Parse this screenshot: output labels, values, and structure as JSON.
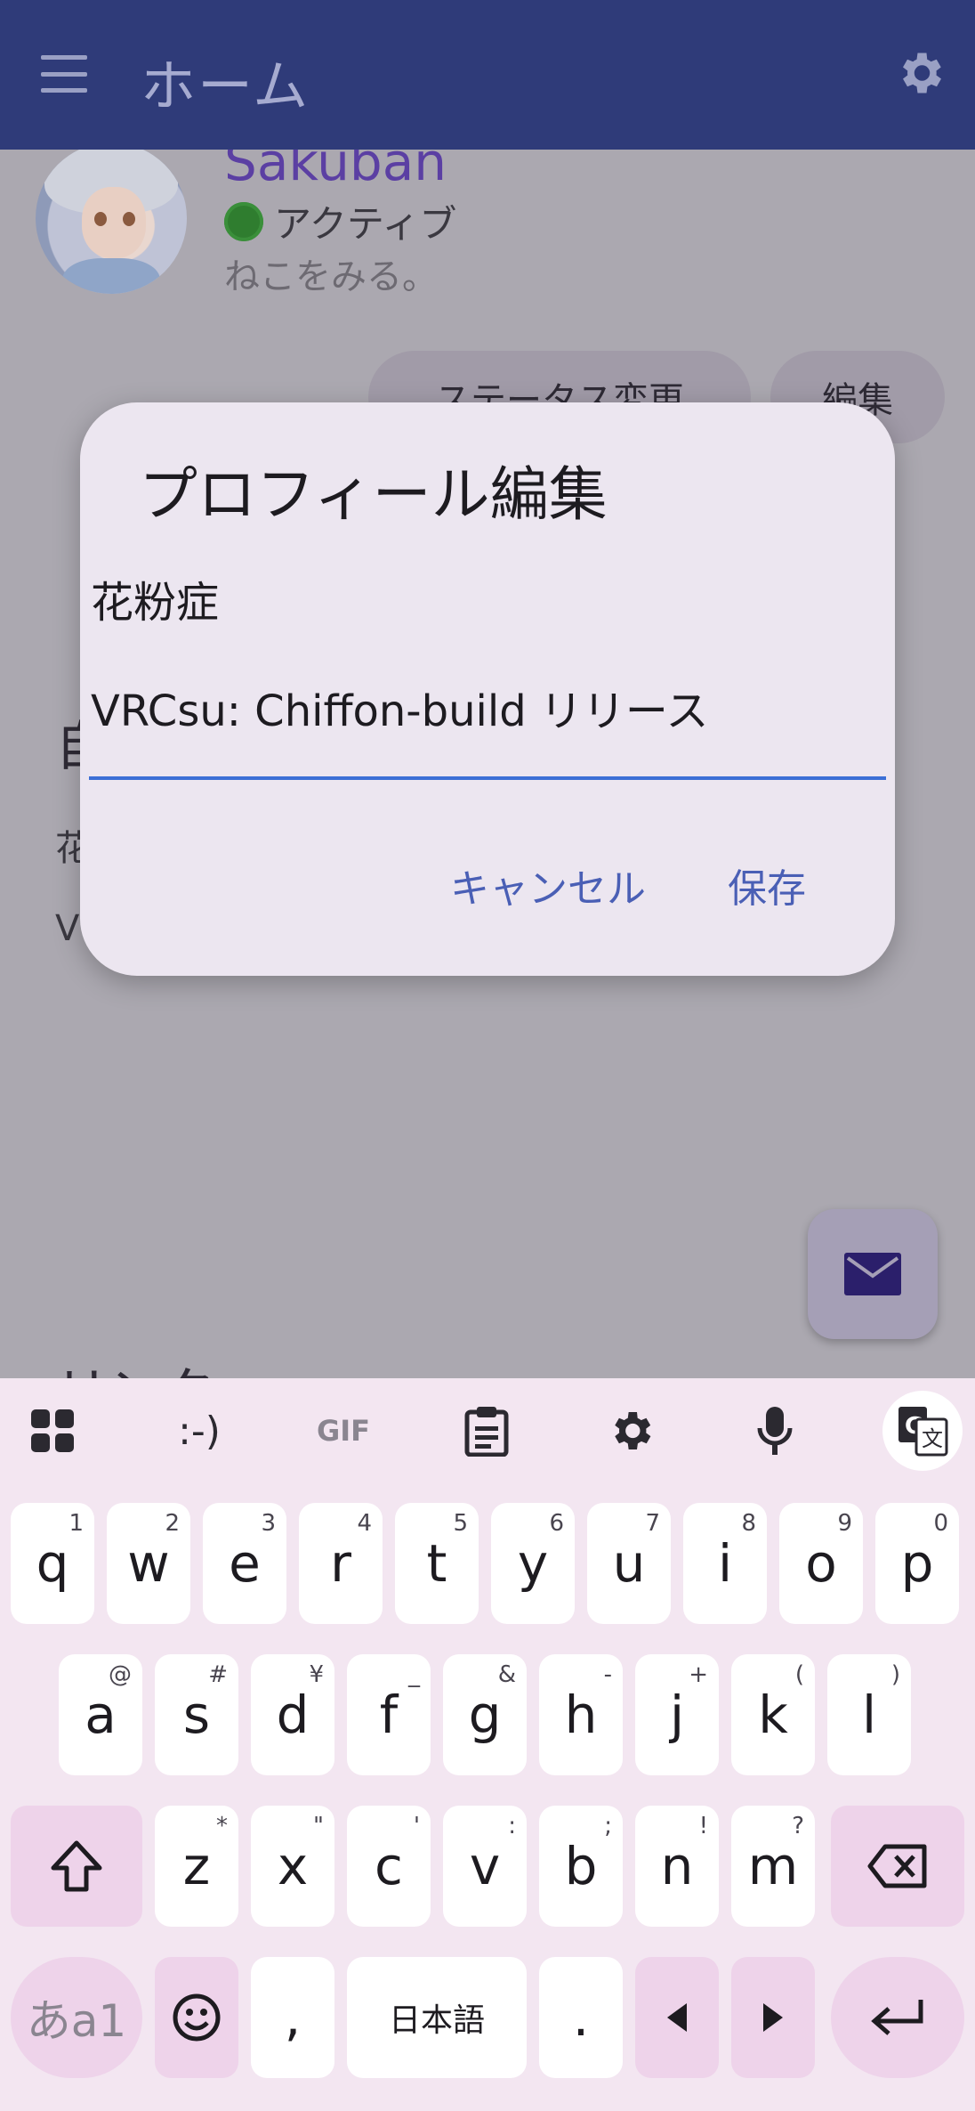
{
  "appbar": {
    "title": "ホーム"
  },
  "profile": {
    "username": "Sakuban",
    "status": "アクティブ",
    "status_message": "ねこをみる。",
    "status_button": "ステータス変更",
    "edit_button": "編集"
  },
  "background": {
    "heading": "自",
    "line1": "花",
    "line2": "V",
    "section": "リンク"
  },
  "dialog": {
    "title": "プロフィール編集",
    "field_line1": "花粉症",
    "field_line2": "VRCsu: Chiffon-build リリース",
    "cancel": "キャンセル",
    "save": "保存"
  },
  "keyboard": {
    "toolbar": {
      "emoticon": ":-)",
      "gif": "GIF"
    },
    "row1": [
      {
        "k": "q",
        "h": "1"
      },
      {
        "k": "w",
        "h": "2"
      },
      {
        "k": "e",
        "h": "3"
      },
      {
        "k": "r",
        "h": "4"
      },
      {
        "k": "t",
        "h": "5"
      },
      {
        "k": "y",
        "h": "6"
      },
      {
        "k": "u",
        "h": "7"
      },
      {
        "k": "i",
        "h": "8"
      },
      {
        "k": "o",
        "h": "9"
      },
      {
        "k": "p",
        "h": "0"
      }
    ],
    "row2": [
      {
        "k": "a",
        "h": "@"
      },
      {
        "k": "s",
        "h": "#"
      },
      {
        "k": "d",
        "h": "¥"
      },
      {
        "k": "f",
        "h": "_"
      },
      {
        "k": "g",
        "h": "&"
      },
      {
        "k": "h",
        "h": "-"
      },
      {
        "k": "j",
        "h": "+"
      },
      {
        "k": "k",
        "h": "("
      },
      {
        "k": "l",
        "h": ")"
      }
    ],
    "row3": [
      {
        "k": "z",
        "h": "*"
      },
      {
        "k": "x",
        "h": "\""
      },
      {
        "k": "c",
        "h": "'"
      },
      {
        "k": "v",
        "h": ":"
      },
      {
        "k": "b",
        "h": ";"
      },
      {
        "k": "n",
        "h": "!"
      },
      {
        "k": "m",
        "h": "?"
      }
    ],
    "mode_key": "あa1",
    "comma": ",",
    "space": "日本語",
    "period": "."
  }
}
